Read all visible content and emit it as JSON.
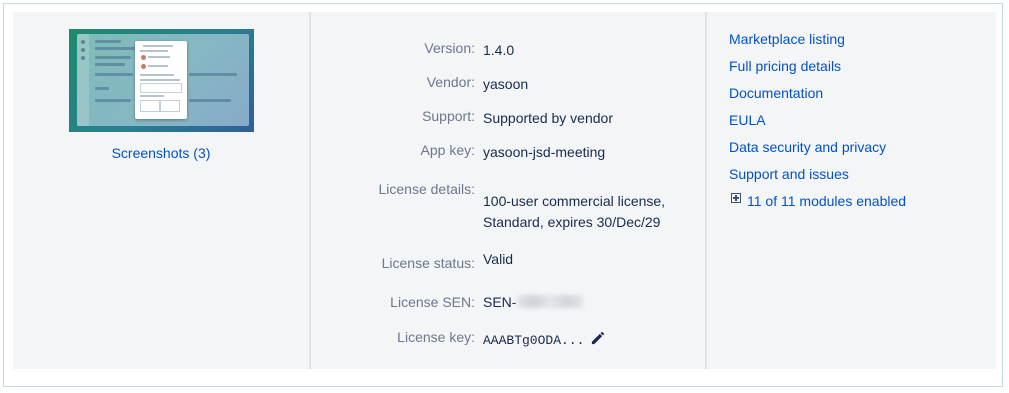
{
  "screenshots": {
    "link_label": "Screenshots (3)"
  },
  "details": [
    {
      "label": "Version:",
      "value": "1.4.0"
    },
    {
      "label": "Vendor:",
      "value": "yasoon"
    },
    {
      "label": "Support:",
      "value": "Supported by vendor"
    },
    {
      "label": "App key:",
      "value": "yasoon-jsd-meeting"
    },
    {
      "label": "License details:",
      "value_line1": "100-user commercial license,",
      "value_line2": "Standard, expires 30/Dec/29"
    },
    {
      "label": "License status:",
      "value": "Valid"
    },
    {
      "label": "License SEN:",
      "value": "SEN-"
    },
    {
      "label": "License key:",
      "value": "AAABTg0ODA..."
    }
  ],
  "links": [
    "Marketplace listing",
    "Full pricing details",
    "Documentation",
    "EULA",
    "Data security and privacy",
    "Support and issues"
  ],
  "modules": {
    "label": "11 of 11 modules enabled"
  },
  "colors": {
    "link": "#0052cc",
    "label": "#6b778c",
    "panel": "#f4f5f7",
    "border": "#c1dbe6"
  },
  "icons": [
    "expand-plus-icon",
    "pencil-edit-icon"
  ]
}
